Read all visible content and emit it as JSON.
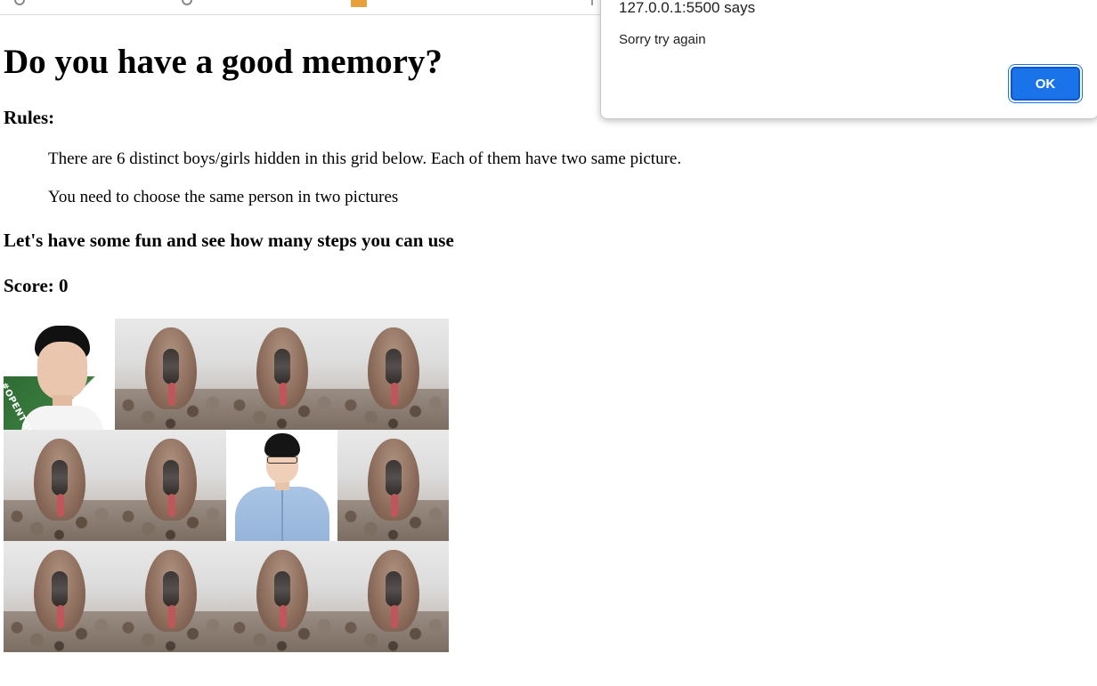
{
  "page": {
    "heading": "Do you have a good memory?",
    "rules_heading": "Rules:",
    "rules": [
      "There are 6 distinct boys/girls hidden in this grid below. Each of them have two same picture.",
      "You need to choose the same person in two pictures"
    ],
    "fun_line": "Let's have some fun and see how many steps you can use",
    "score_text": "Score: 0"
  },
  "grid": {
    "rows": 3,
    "columns": 4,
    "cards": [
      {
        "state": "revealed",
        "image": "person-photo-1"
      },
      {
        "state": "hidden",
        "image": "card-back"
      },
      {
        "state": "hidden",
        "image": "card-back"
      },
      {
        "state": "hidden",
        "image": "card-back"
      },
      {
        "state": "hidden",
        "image": "card-back"
      },
      {
        "state": "hidden",
        "image": "card-back"
      },
      {
        "state": "revealed",
        "image": "person-photo-2"
      },
      {
        "state": "hidden",
        "image": "card-back"
      },
      {
        "state": "hidden",
        "image": "card-back"
      },
      {
        "state": "hidden",
        "image": "card-back"
      },
      {
        "state": "hidden",
        "image": "card-back"
      },
      {
        "state": "hidden",
        "image": "card-back"
      }
    ],
    "photo_1_banner": "#OPENTOWORK"
  },
  "alert": {
    "title": "127.0.0.1:5500 says",
    "message": "Sorry try again",
    "ok_label": "OK",
    "button_color": "#1a73e8"
  }
}
